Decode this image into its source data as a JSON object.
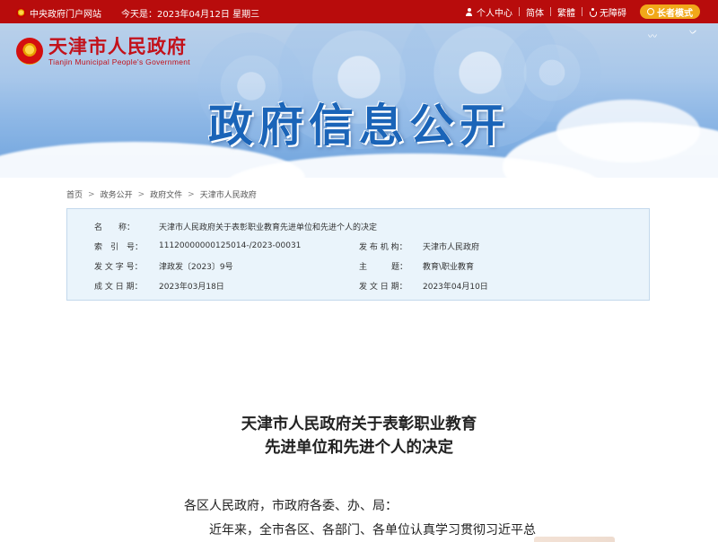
{
  "topbar": {
    "portal_link": "中央政府门户网站",
    "date_text": "今天是：2023年04月12日 星期三",
    "personal_center": "个人中心",
    "simplified": "简体",
    "traditional": "繁體",
    "accessibility": "无障碍",
    "elder_mode": "长者模式"
  },
  "header": {
    "site_name_cn": "天津市人民政府",
    "site_name_en": "Tianjin Municipal People's Government",
    "banner_title": "政府信息公开"
  },
  "breadcrumb": [
    "首页",
    "政务公开",
    "政府文件",
    "天津市人民政府"
  ],
  "info": {
    "name_label": "名　　称：",
    "name_value": "天津市人民政府关于表彰职业教育先进单位和先进个人的决定",
    "index_label": "索　引　号：",
    "index_value": "11120000000125014-/2023-00031",
    "issuer_label": "发 布 机 构：",
    "issuer_value": "天津市人民政府",
    "docno_label": "发 文 字 号：",
    "docno_value": "津政发〔2023〕9号",
    "topic_label": "主　　　题：",
    "topic_value": "教育\\职业教育",
    "created_label": "成 文 日 期：",
    "created_value": "2023年03月18日",
    "published_label": "发 文 日 期：",
    "published_value": "2023年04月10日"
  },
  "article": {
    "title_line1": "天津市人民政府关于表彰职业教育",
    "title_line2": "先进单位和先进个人的决定",
    "salutation": "各区人民政府，市政府各委、办、局：",
    "para1": "近年来，全市各区、各部门、各单位认真学习贯彻习近平总"
  },
  "colors": {
    "topbar": "#b80c0c",
    "accent_gold": "#f1a81a",
    "banner_title": "#1a64b8",
    "info_bg": "#eaf4fb"
  }
}
